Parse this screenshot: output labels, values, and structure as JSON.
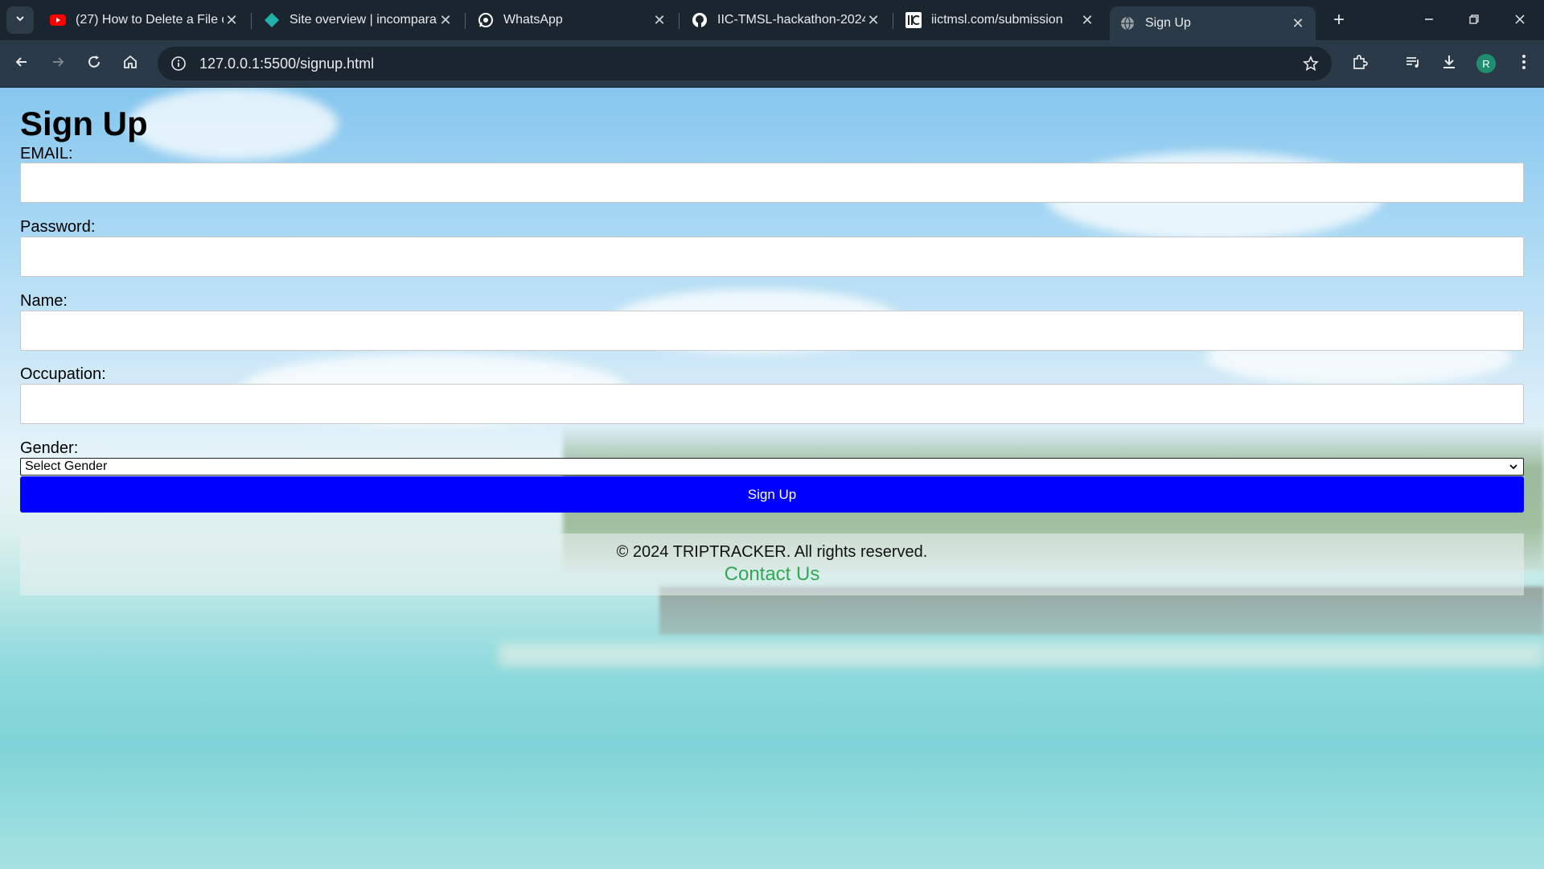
{
  "browser": {
    "tabs": [
      {
        "title": "(27) How to Delete a File o",
        "icon": "youtube-icon",
        "active": false
      },
      {
        "title": "Site overview | incomparab",
        "icon": "netlify-icon",
        "active": false
      },
      {
        "title": "WhatsApp",
        "icon": "whatsapp-icon",
        "active": false
      },
      {
        "title": "IIC-TMSL-hackathon-2024-",
        "icon": "github-icon",
        "active": false
      },
      {
        "title": "iictmsl.com/submission",
        "icon": "iic-icon",
        "active": false
      },
      {
        "title": "Sign Up",
        "icon": "globe-icon",
        "active": true
      }
    ],
    "url": "127.0.0.1:5500/signup.html",
    "profile_initial": "R"
  },
  "page": {
    "title": "Sign Up",
    "fields": {
      "email_label": "EMAIL:",
      "password_label": "Password:",
      "name_label": "Name:",
      "occupation_label": "Occupation:",
      "gender_label": "Gender:"
    },
    "gender_select": "Select Gender",
    "submit_label": "Sign Up",
    "footer": {
      "copyright": "© 2024 TRIPTRACKER. All rights reserved.",
      "contact": "Contact Us"
    }
  },
  "colors": {
    "submit_button": "#0000ff",
    "contact_link": "#33a853",
    "chrome_bg": "#2b3a49"
  }
}
